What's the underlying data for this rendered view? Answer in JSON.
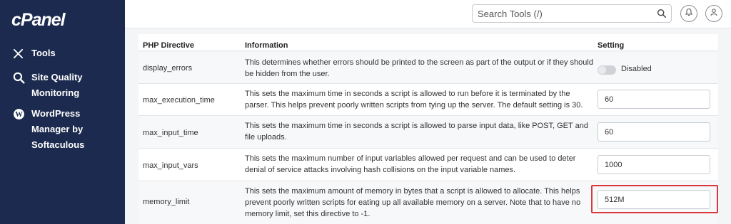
{
  "sidebar": {
    "logo": "cPanel",
    "items": [
      {
        "label": "Tools",
        "icon": "tools-icon"
      },
      {
        "label": "Site Quality Monitoring",
        "icon": "search-quality-icon"
      },
      {
        "label": "WordPress Manager by Softaculous",
        "icon": "wordpress-icon"
      }
    ]
  },
  "header": {
    "search_placeholder": "Search Tools (/)"
  },
  "table": {
    "headers": [
      "PHP Directive",
      "Information",
      "Setting"
    ],
    "rows": [
      {
        "directive": "display_errors",
        "info": "This determines whether errors should be printed to the screen as part of the output or if they should be hidden from the user.",
        "setting_type": "toggle",
        "setting": "Disabled"
      },
      {
        "directive": "max_execution_time",
        "info": "This sets the maximum time in seconds a script is allowed to run before it is terminated by the parser. This helps prevent poorly written scripts from tying up the server. The default setting is 30.",
        "setting_type": "input",
        "setting": "60"
      },
      {
        "directive": "max_input_time",
        "info": "This sets the maximum time in seconds a script is allowed to parse input data, like POST, GET and file uploads.",
        "setting_type": "input",
        "setting": "60"
      },
      {
        "directive": "max_input_vars",
        "info": "This sets the maximum number of input variables allowed per request and can be used to deter denial of service attacks involving hash collisions on the input variable names.",
        "setting_type": "input",
        "setting": "1000"
      },
      {
        "directive": "memory_limit",
        "info": "This sets the maximum amount of memory in bytes that a script is allowed to allocate. This helps prevent poorly written scripts for eating up all available memory on a server. Note that to have no memory limit, set this directive to -1.",
        "setting_type": "input",
        "setting": "512M"
      }
    ]
  },
  "colors": {
    "sidebar_bg": "#1b2a4e",
    "highlight": "#d9363e"
  }
}
